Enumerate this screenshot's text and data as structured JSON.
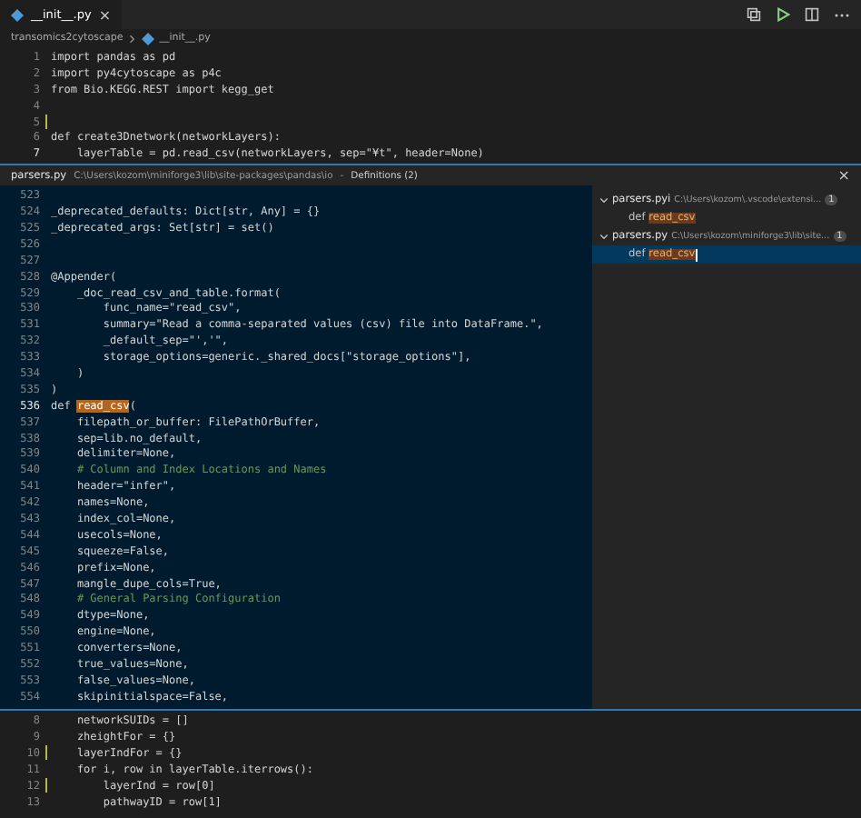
{
  "tab": {
    "title": "__init__.py",
    "selected": true,
    "close": "×"
  },
  "breadcrumbs": [
    "transomics2cytoscape",
    "__init__.py"
  ],
  "editor_top": [
    {
      "number": "1",
      "text": "import pandas as pd",
      "modified": false,
      "current": false
    },
    {
      "number": "2",
      "text": "import py4cytoscape as p4c",
      "modified": false,
      "current": false
    },
    {
      "number": "3",
      "text": "from Bio.KEGG.REST import kegg_get",
      "modified": false,
      "current": false
    },
    {
      "number": "4",
      "modified": false,
      "current": false
    },
    {
      "number": "5",
      "modified": true,
      "current": false
    },
    {
      "number": "6",
      "text": "def create3Dnetwork(networkLayers):",
      "modified": false,
      "current": false
    },
    {
      "number": "7",
      "text": "    layerTable = pd.read_csv(networkLayers, sep=\"¥t\", header=None)",
      "modified": false,
      "current": true
    }
  ],
  "peek": {
    "file": "parsers.py",
    "path": "C:\\Users\\kozom\\miniforge3\\lib\\site-packages\\pandas\\io",
    "separator": "-",
    "title": "Definitions (2)",
    "close": "×",
    "lines": [
      {
        "number": "523",
        "kind": "code"
      },
      {
        "number": "524",
        "text": "_deprecated_defaults: Dict[str, Any] = {}",
        "kind": "code"
      },
      {
        "number": "525",
        "text": "_deprecated_args: Set[str] = set()",
        "kind": "code"
      },
      {
        "number": "526",
        "kind": "code"
      },
      {
        "number": "527",
        "kind": "code"
      },
      {
        "number": "528",
        "text": "@Appender(",
        "kind": "code"
      },
      {
        "number": "529",
        "text": "    _doc_read_csv_and_table.format(",
        "kind": "code"
      },
      {
        "number": "530",
        "text": "        func_name=\"read_csv\",",
        "kind": "code"
      },
      {
        "number": "531",
        "text": "        summary=\"Read a comma-separated values (csv) file into DataFrame.\",",
        "kind": "code"
      },
      {
        "number": "532",
        "text": "        _default_sep=\"','\",",
        "kind": "code"
      },
      {
        "number": "533",
        "text": "        storage_options=generic._shared_docs[\"storage_options\"],",
        "kind": "code"
      },
      {
        "number": "534",
        "text": "    )",
        "kind": "code"
      },
      {
        "number": "535",
        "text": ")",
        "kind": "code"
      },
      {
        "number": "536",
        "text": "def ",
        "match": "read_csv",
        "after": "(",
        "kind": "code"
      },
      {
        "number": "537",
        "text": "    filepath_or_buffer: FilePathOrBuffer,",
        "kind": "code"
      },
      {
        "number": "538",
        "text": "    sep=lib.no_default,",
        "kind": "code"
      },
      {
        "number": "539",
        "text": "    delimiter=None,",
        "kind": "code"
      },
      {
        "number": "540",
        "text": "    # Column and Index Locations and Names",
        "kind": "comment"
      },
      {
        "number": "541",
        "text": "    header=\"infer\",",
        "kind": "code"
      },
      {
        "number": "542",
        "text": "    names=None,",
        "kind": "code"
      },
      {
        "number": "543",
        "text": "    index_col=None,",
        "kind": "code"
      },
      {
        "number": "544",
        "text": "    usecols=None,",
        "kind": "code"
      },
      {
        "number": "545",
        "text": "    squeeze=False,",
        "kind": "code"
      },
      {
        "number": "546",
        "text": "    prefix=None,",
        "kind": "code"
      },
      {
        "number": "547",
        "text": "    mangle_dupe_cols=True,",
        "kind": "code"
      },
      {
        "number": "548",
        "text": "    # General Parsing Configuration",
        "kind": "comment"
      },
      {
        "number": "549",
        "text": "    dtype=None,",
        "kind": "code"
      },
      {
        "number": "550",
        "text": "    engine=None,",
        "kind": "code"
      },
      {
        "number": "551",
        "text": "    converters=None,",
        "kind": "code"
      },
      {
        "number": "552",
        "text": "    true_values=None,",
        "kind": "code"
      },
      {
        "number": "553",
        "text": "    false_values=None,",
        "kind": "code"
      },
      {
        "number": "554",
        "text": "    skipinitialspace=False,",
        "kind": "code"
      }
    ],
    "references": [
      {
        "file": "parsers.pyi",
        "path": "C:\\Users\\kozom\\.vscode\\extensi...",
        "count": "1",
        "expanded": true,
        "items": [
          {
            "prefix": "def ",
            "match": "read_csv",
            "selected": false
          }
        ]
      },
      {
        "file": "parsers.py",
        "path": "C:\\Users\\kozom\\miniforge3\\lib\\site...",
        "count": "1",
        "expanded": true,
        "items": [
          {
            "prefix": "def ",
            "match": "read_csv",
            "selected": true
          }
        ]
      }
    ]
  },
  "editor_bottom": [
    {
      "number": "8",
      "text": "    networkSUIDs = []",
      "modified": false,
      "current": false
    },
    {
      "number": "9",
      "text": "    zheightFor = {}",
      "modified": false,
      "current": false
    },
    {
      "number": "10",
      "text": "    layerIndFor = {}",
      "modified": true,
      "current": false
    },
    {
      "number": "11",
      "text": "    for i, row in layerTable.iterrows():",
      "modified": false,
      "current": false
    },
    {
      "number": "12",
      "text": "        layerInd = row[0]",
      "modified": true,
      "current": false
    },
    {
      "number": "13",
      "text": "        pathwayID = row[1]",
      "modified": false,
      "current": false
    }
  ]
}
